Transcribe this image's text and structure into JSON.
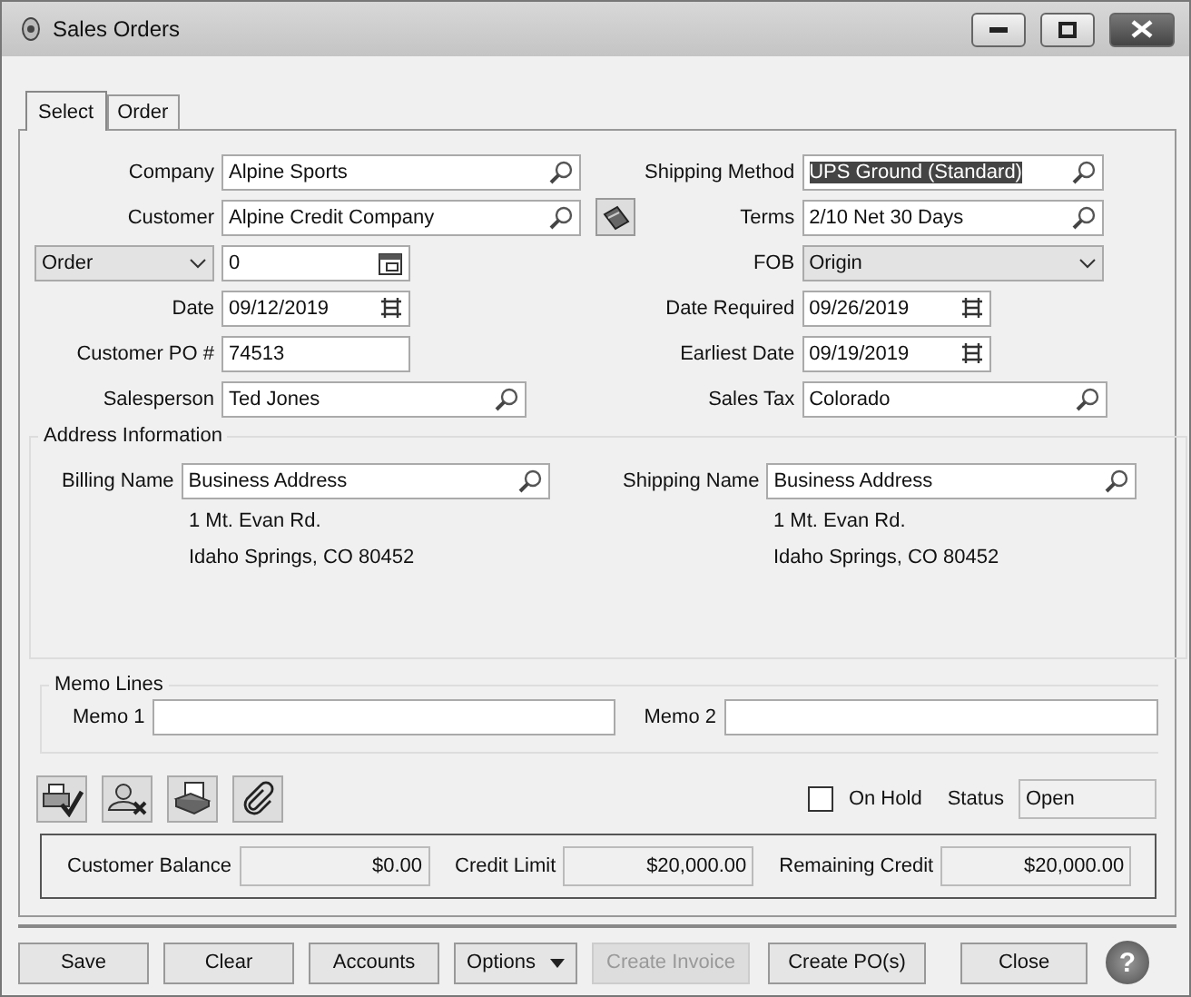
{
  "window": {
    "title": "Sales Orders"
  },
  "tabs": [
    {
      "label": "Select",
      "selected": true
    },
    {
      "label": "Order",
      "selected": false
    }
  ],
  "left_fields": [
    {
      "kind": "lookup",
      "label": "Company",
      "value": "Alpine Sports",
      "highlighted": false
    },
    {
      "kind": "lookup_button",
      "label": "Customer",
      "value": "Alpine Credit Company",
      "highlighted": false
    },
    {
      "kind": "select_number",
      "option": "Order",
      "value": "0"
    },
    {
      "kind": "date",
      "label": "Date",
      "value": "09/12/2019"
    },
    {
      "kind": "text",
      "label": "Customer PO #",
      "value": "74513"
    },
    {
      "kind": "lookup",
      "label": "Salesperson",
      "value": "Ted Jones",
      "highlighted": false
    }
  ],
  "right_fields": [
    {
      "kind": "lookup",
      "label": "Shipping Method",
      "value": "UPS Ground (Standard)",
      "highlighted": true
    },
    {
      "kind": "lookup",
      "label": "Terms",
      "value": "2/10 Net 30 Days",
      "highlighted": false
    },
    {
      "kind": "dropdown",
      "label": "FOB",
      "value": "Origin"
    },
    {
      "kind": "date",
      "label": "Date Required",
      "value": "09/26/2019"
    },
    {
      "kind": "date",
      "label": "Earliest Date",
      "value": "09/19/2019"
    },
    {
      "kind": "lookup",
      "label": "Sales Tax",
      "value": "Colorado",
      "highlighted": false
    }
  ],
  "address": {
    "title": "Address Information",
    "billing": {
      "label": "Billing Name",
      "value": "Business Address",
      "lines": [
        "1 Mt. Evan Rd.",
        "Idaho Springs, CO  80452"
      ]
    },
    "shipping": {
      "label": "Shipping Name",
      "value": "Business Address",
      "lines": [
        "1 Mt. Evan Rd.",
        "Idaho Springs, CO  80452"
      ]
    }
  },
  "memo": {
    "title": "Memo Lines",
    "fields": [
      {
        "label": "Memo 1"
      },
      {
        "label": "Memo 2"
      }
    ]
  },
  "on_hold": {
    "label": "On Hold",
    "checked": false
  },
  "status": {
    "label": "Status",
    "value": "Open"
  },
  "balances": [
    {
      "label": "Customer Balance",
      "value": "$0.00"
    },
    {
      "label": "Credit Limit",
      "value": "$20,000.00"
    },
    {
      "label": "Remaining Credit",
      "value": "$20,000.00"
    }
  ],
  "buttons": [
    {
      "kind": "button",
      "label": "Save",
      "disabled": false
    },
    {
      "kind": "button",
      "label": "Clear",
      "disabled": false
    },
    {
      "kind": "button",
      "label": "Accounts",
      "disabled": false
    },
    {
      "kind": "menu",
      "label": "Options",
      "disabled": false
    },
    {
      "kind": "button",
      "label": "Create Invoice",
      "disabled": true
    },
    {
      "kind": "button",
      "label": "Create PO(s)",
      "disabled": false
    },
    {
      "kind": "button",
      "label": "Close",
      "disabled": false
    }
  ],
  "help": "?"
}
